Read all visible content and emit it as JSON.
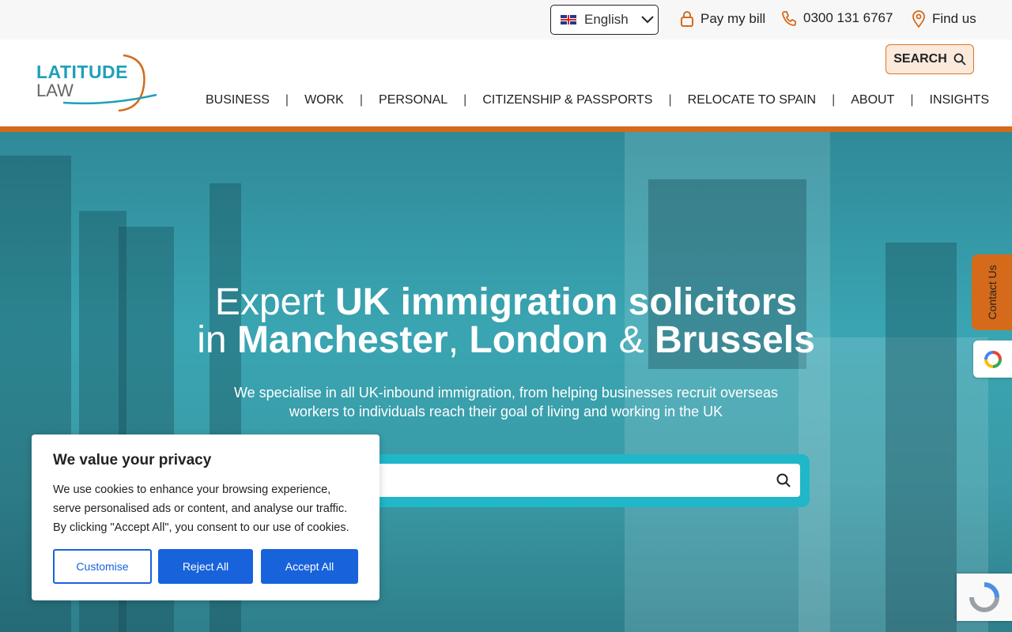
{
  "topbar": {
    "language": "English",
    "pay_bill": "Pay my bill",
    "phone": "0300 131 6767",
    "find_us": "Find us"
  },
  "header": {
    "logo_line1": "LATITUDE",
    "logo_line2": "LAW",
    "search_label": "SEARCH",
    "nav": [
      "BUSINESS",
      "WORK",
      "PERSONAL",
      "CITIZENSHIP & PASSPORTS",
      "RELOCATE TO SPAIN",
      "ABOUT",
      "INSIGHTS"
    ]
  },
  "hero": {
    "line1_a": "Expert ",
    "line1_b": "UK immigration solicitors",
    "line2_a": "in ",
    "line2_b": "Manchester",
    "line2_c": ", ",
    "line2_d": "London",
    "line2_e": " & ",
    "line2_f": "Brussels",
    "subtitle": "We specialise in all UK-inbound immigration, from helping businesses recruit overseas workers to individuals reach their goal of living and working in the UK"
  },
  "side": {
    "contact_tab": "Contact Us"
  },
  "cookie": {
    "title": "We value your privacy",
    "body": "We use cookies to enhance your browsing experience, serve personalised ads or content, and analyse our traffic. By clicking \"Accept All\", you consent to our use of cookies.",
    "customise": "Customise",
    "reject": "Reject All",
    "accept": "Accept All"
  },
  "colors": {
    "brand_orange": "#d46a1a",
    "brand_teal": "#1ea0b8",
    "cookie_blue": "#1863dc"
  }
}
